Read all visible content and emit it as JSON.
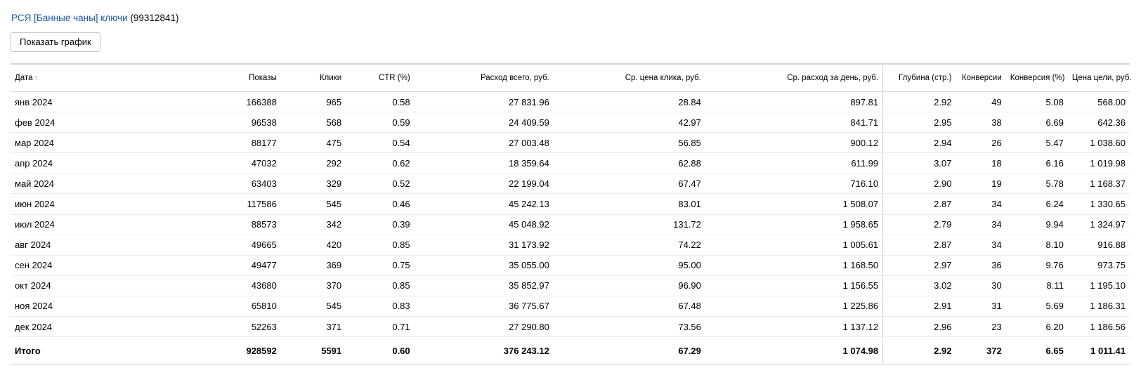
{
  "header": {
    "campaign_link": "РСЯ [Банные чаны] ключи",
    "campaign_id": "(99312841)"
  },
  "toolbar": {
    "show_chart_label": "Показать график"
  },
  "table": {
    "columns": {
      "date": "Дата",
      "sort_arrow": "↑",
      "shows": "Показы",
      "clicks": "Клики",
      "ctr": "CTR (%)",
      "spend": "Расход всего, руб.",
      "avg_cpc": "Ср. цена клика, руб.",
      "avg_daily_spend": "Ср. расход за день, руб.",
      "depth": "Глубина (стр.)",
      "conversions": "Конверсии",
      "conversion_rate": "Конверсия (%)",
      "cost_per_goal": "Цена цели, руб."
    },
    "rows": [
      {
        "date": "янв 2024",
        "shows": "166388",
        "clicks": "965",
        "ctr": "0.58",
        "spend": "27 831.96",
        "avg_cpc": "28.84",
        "avg_daily_spend": "897.81",
        "depth": "2.92",
        "conversions": "49",
        "conversion_rate": "5.08",
        "cost_per_goal": "568.00"
      },
      {
        "date": "фев 2024",
        "shows": "96538",
        "clicks": "568",
        "ctr": "0.59",
        "spend": "24 409.59",
        "avg_cpc": "42.97",
        "avg_daily_spend": "841.71",
        "depth": "2.95",
        "conversions": "38",
        "conversion_rate": "6.69",
        "cost_per_goal": "642.36"
      },
      {
        "date": "мар 2024",
        "shows": "88177",
        "clicks": "475",
        "ctr": "0.54",
        "spend": "27 003.48",
        "avg_cpc": "56.85",
        "avg_daily_spend": "900.12",
        "depth": "2.94",
        "conversions": "26",
        "conversion_rate": "5.47",
        "cost_per_goal": "1 038.60"
      },
      {
        "date": "апр 2024",
        "shows": "47032",
        "clicks": "292",
        "ctr": "0.62",
        "spend": "18 359.64",
        "avg_cpc": "62.88",
        "avg_daily_spend": "611.99",
        "depth": "3.07",
        "conversions": "18",
        "conversion_rate": "6.16",
        "cost_per_goal": "1 019.98"
      },
      {
        "date": "май 2024",
        "shows": "63403",
        "clicks": "329",
        "ctr": "0.52",
        "spend": "22 199.04",
        "avg_cpc": "67.47",
        "avg_daily_spend": "716.10",
        "depth": "2.90",
        "conversions": "19",
        "conversion_rate": "5.78",
        "cost_per_goal": "1 168.37"
      },
      {
        "date": "июн 2024",
        "shows": "117586",
        "clicks": "545",
        "ctr": "0.46",
        "spend": "45 242.13",
        "avg_cpc": "83.01",
        "avg_daily_spend": "1 508.07",
        "depth": "2.87",
        "conversions": "34",
        "conversion_rate": "6.24",
        "cost_per_goal": "1 330.65"
      },
      {
        "date": "июл 2024",
        "shows": "88573",
        "clicks": "342",
        "ctr": "0.39",
        "spend": "45 048.92",
        "avg_cpc": "131.72",
        "avg_daily_spend": "1 958.65",
        "depth": "2.79",
        "conversions": "34",
        "conversion_rate": "9.94",
        "cost_per_goal": "1 324.97"
      },
      {
        "date": "авг 2024",
        "shows": "49665",
        "clicks": "420",
        "ctr": "0.85",
        "spend": "31 173.92",
        "avg_cpc": "74.22",
        "avg_daily_spend": "1 005.61",
        "depth": "2.87",
        "conversions": "34",
        "conversion_rate": "8.10",
        "cost_per_goal": "916.88"
      },
      {
        "date": "сен 2024",
        "shows": "49477",
        "clicks": "369",
        "ctr": "0.75",
        "spend": "35 055.00",
        "avg_cpc": "95.00",
        "avg_daily_spend": "1 168.50",
        "depth": "2.97",
        "conversions": "36",
        "conversion_rate": "9.76",
        "cost_per_goal": "973.75"
      },
      {
        "date": "окт 2024",
        "shows": "43680",
        "clicks": "370",
        "ctr": "0.85",
        "spend": "35 852.97",
        "avg_cpc": "96.90",
        "avg_daily_spend": "1 156.55",
        "depth": "3.02",
        "conversions": "30",
        "conversion_rate": "8.11",
        "cost_per_goal": "1 195.10"
      },
      {
        "date": "ноя 2024",
        "shows": "65810",
        "clicks": "545",
        "ctr": "0.83",
        "spend": "36 775.67",
        "avg_cpc": "67.48",
        "avg_daily_spend": "1 225.86",
        "depth": "2.91",
        "conversions": "31",
        "conversion_rate": "5.69",
        "cost_per_goal": "1 186.31"
      },
      {
        "date": "дек 2024",
        "shows": "52263",
        "clicks": "371",
        "ctr": "0.71",
        "spend": "27 290.80",
        "avg_cpc": "73.56",
        "avg_daily_spend": "1 137.12",
        "depth": "2.96",
        "conversions": "23",
        "conversion_rate": "6.20",
        "cost_per_goal": "1 186.56"
      }
    ],
    "total": {
      "date": "Итого",
      "shows": "928592",
      "clicks": "5591",
      "ctr": "0.60",
      "spend": "376 243.12",
      "avg_cpc": "67.29",
      "avg_daily_spend": "1 074.98",
      "depth": "2.92",
      "conversions": "372",
      "conversion_rate": "6.65",
      "cost_per_goal": "1 011.41"
    }
  },
  "colors": {
    "link": "#1a5aa8",
    "border": "#d4d4d4",
    "row_divider": "#ececec"
  }
}
